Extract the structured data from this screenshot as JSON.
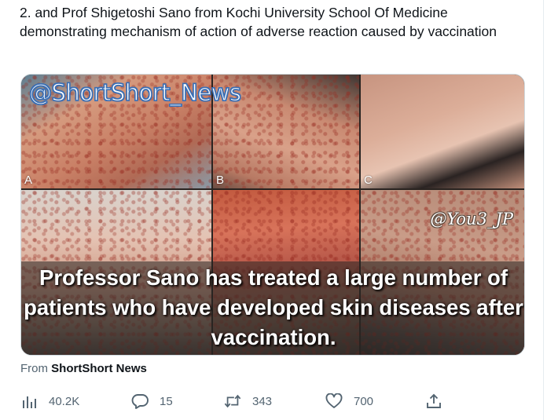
{
  "tweet": {
    "text": "2. and Prof Shigetoshi Sano from Kochi University School Of Medicine demonstrating mechanism of action of adverse reaction caused by vaccination"
  },
  "media": {
    "watermark_top": "@ShortShort_News",
    "watermark_right": "@You3_JP",
    "panel_labels": [
      "A",
      "B",
      "C"
    ],
    "caption": "Professor Sano has treated a large number of patients who have developed skin diseases after vaccination."
  },
  "source": {
    "prefix": "From",
    "name": "ShortShort News"
  },
  "actions": {
    "views": "40.2K",
    "replies": "15",
    "retweets": "343",
    "likes": "700"
  },
  "colors": {
    "text": "#0f1419",
    "muted": "#536471",
    "watermark_stroke": "#3a6fb5"
  }
}
